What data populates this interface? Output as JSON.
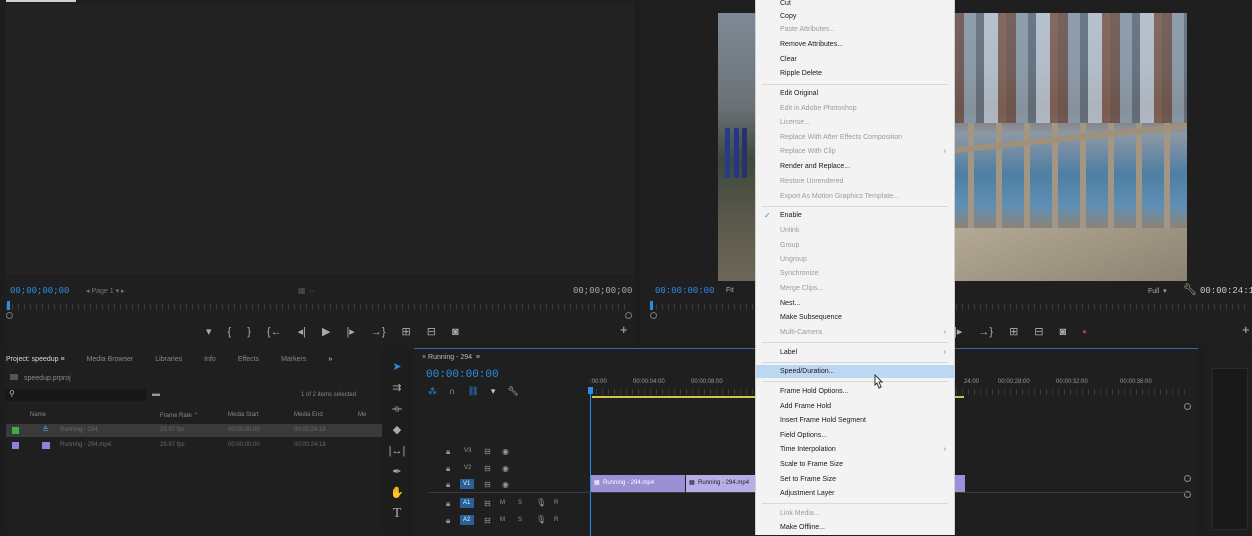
{
  "source_monitor": {
    "timecode_in": "00;00;00;00",
    "page_selector": "Page 1",
    "timecode_out": "00;00;00;00"
  },
  "program_monitor": {
    "timecode": "00:00:00:00",
    "fit_label": "Fit",
    "quality": "Full",
    "duration": "00:00:24:1"
  },
  "project_panel": {
    "tabs": [
      "Project: speedup",
      "Media Browser",
      "Libraries",
      "Info",
      "Effects",
      "Markers"
    ],
    "file_name": "speedup.prproj",
    "selection_count": "1 of 2 items selected",
    "columns": [
      "Name",
      "Frame Rate",
      "Media Start",
      "Media End",
      "Me"
    ],
    "rows": [
      {
        "name": "Running - 294",
        "frame_rate": "29.97 fps",
        "media_start": "00:00:00:00",
        "media_end": "00:00:24:18",
        "color": "#3fae47"
      },
      {
        "name": "Running - 294.mp4",
        "frame_rate": "29.97 fps",
        "media_start": "00:00:00:00",
        "media_end": "00:00:24:18",
        "color": "#8e7fe0"
      }
    ]
  },
  "timeline": {
    "sequence_name": "Running - 294",
    "timecode": "00:00:00:00",
    "ruler_left": [
      ":00:00",
      "00:00:04:00",
      "00:00:08:00"
    ],
    "ruler_right": [
      "24:00",
      "00:00:28:00",
      "00:00:32:00",
      "00:00:36:00"
    ],
    "tracks": [
      {
        "name": "V3",
        "kind": "video"
      },
      {
        "name": "V2",
        "kind": "video"
      },
      {
        "name": "V1",
        "kind": "video"
      },
      {
        "name": "A1",
        "kind": "audio"
      },
      {
        "name": "A2",
        "kind": "audio"
      }
    ],
    "track_labels": {
      "mute": "M",
      "solo": "S",
      "record": "R"
    },
    "clips": [
      "Running - 294.mp4",
      "Running - 294.mp4"
    ]
  },
  "context_menu": {
    "items": [
      {
        "label": "Cut",
        "disabled": false
      },
      {
        "label": "Copy",
        "disabled": false
      },
      {
        "label": "Paste Attributes...",
        "disabled": true
      },
      {
        "label": "Remove Attributes...",
        "disabled": false
      },
      {
        "label": "Clear",
        "disabled": false
      },
      {
        "label": "Ripple Delete",
        "disabled": false
      },
      {
        "label": "Edit Original",
        "disabled": false
      },
      {
        "label": "Edit in Adobe Photoshop",
        "disabled": true
      },
      {
        "label": "License...",
        "disabled": true
      },
      {
        "label": "Replace With After Effects Composition",
        "disabled": true
      },
      {
        "label": "Replace With Clip",
        "disabled": true
      },
      {
        "label": "Render and Replace...",
        "disabled": false
      },
      {
        "label": "Restore Unrendered",
        "disabled": true
      },
      {
        "label": "Export As Motion Graphics Template...",
        "disabled": true
      },
      {
        "label": "Enable",
        "disabled": false
      },
      {
        "label": "Unlink",
        "disabled": true
      },
      {
        "label": "Group",
        "disabled": true
      },
      {
        "label": "Ungroup",
        "disabled": true
      },
      {
        "label": "Synchronize",
        "disabled": true
      },
      {
        "label": "Merge Clips...",
        "disabled": true
      },
      {
        "label": "Nest...",
        "disabled": false
      },
      {
        "label": "Make Subsequence",
        "disabled": false
      },
      {
        "label": "Multi-Camera",
        "disabled": true
      },
      {
        "label": "Label",
        "disabled": false
      },
      {
        "label": "Speed/Duration...",
        "disabled": false
      },
      {
        "label": "Frame Hold Options...",
        "disabled": false
      },
      {
        "label": "Add Frame Hold",
        "disabled": false
      },
      {
        "label": "Insert Frame Hold Segment",
        "disabled": false
      },
      {
        "label": "Field Options...",
        "disabled": false
      },
      {
        "label": "Time Interpolation",
        "disabled": false
      },
      {
        "label": "Scale to Frame Size",
        "disabled": false
      },
      {
        "label": "Set to Frame Size",
        "disabled": false
      },
      {
        "label": "Adjustment Layer",
        "disabled": false
      },
      {
        "label": "Link Media...",
        "disabled": true
      },
      {
        "label": "Make Offline...",
        "disabled": false
      }
    ]
  },
  "colors": {
    "accent": "#2d8ceb",
    "highlight": "#bcd7f1",
    "clip": "#9b8fd6",
    "clip_light": "#b7aee6"
  }
}
